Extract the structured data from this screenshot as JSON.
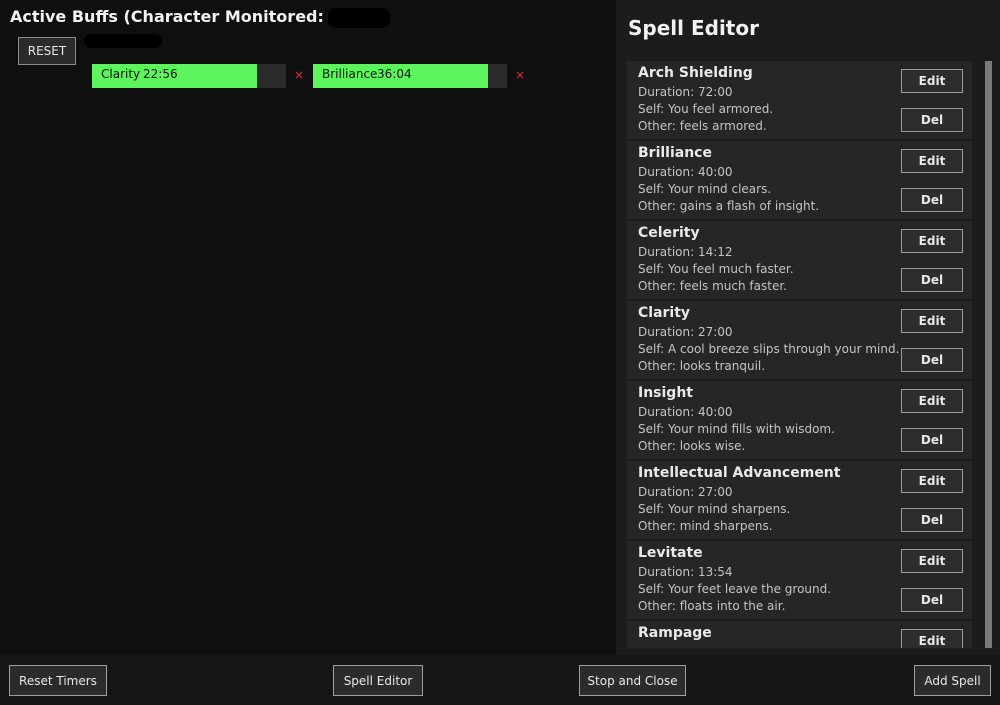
{
  "active_buffs": {
    "title": "Active Buffs  (Character Monitored:",
    "reset_label": "RESET",
    "remove_glyph": "×",
    "buffs": [
      {
        "name": "Clarity",
        "time": "22:56",
        "fraction_remaining": 0.85
      },
      {
        "name": "Brilliance",
        "time": "36:04",
        "fraction_remaining": 0.9
      }
    ]
  },
  "spell_editor": {
    "title": "Spell Editor",
    "edit_label": "Edit",
    "del_label": "Del",
    "spells": [
      {
        "name": "Arch Shielding",
        "duration": "Duration: 72:00",
        "self": "Self: You feel armored.",
        "other": "Other: feels armored."
      },
      {
        "name": "Brilliance",
        "duration": "Duration: 40:00",
        "self": "Self: Your mind clears.",
        "other": "Other: gains a flash of insight."
      },
      {
        "name": "Celerity",
        "duration": "Duration: 14:12",
        "self": "Self: You feel much faster.",
        "other": "Other: feels much faster."
      },
      {
        "name": "Clarity",
        "duration": "Duration: 27:00",
        "self": "Self: A cool breeze slips through your mind.",
        "other": "Other: looks tranquil."
      },
      {
        "name": "Insight",
        "duration": "Duration: 40:00",
        "self": "Self: Your mind fills with wisdom.",
        "other": "Other: looks wise."
      },
      {
        "name": "Intellectual Advancement",
        "duration": "Duration: 27:00",
        "self": "Self: Your mind sharpens.",
        "other": "Other: mind sharpens."
      },
      {
        "name": "Levitate",
        "duration": "Duration: 13:54",
        "self": "Self: Your feet leave the ground.",
        "other": "Other: floats into the air."
      },
      {
        "name": "Rampage",
        "duration": "",
        "self": "",
        "other": ""
      }
    ]
  },
  "footer": {
    "reset_timers": "Reset Timers",
    "spell_editor": "Spell Editor",
    "stop_and_close": "Stop and Close",
    "add_spell": "Add Spell"
  },
  "colors": {
    "buff_fill": "#5df55d",
    "remove_x": "#e03030",
    "background": "#0f0f0f",
    "panel": "#1c1c1c"
  }
}
